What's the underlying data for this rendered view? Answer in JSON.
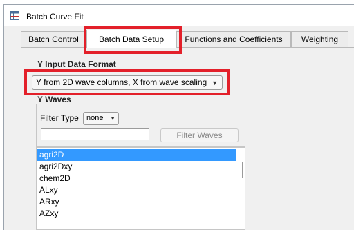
{
  "window": {
    "title": "Batch Curve Fit"
  },
  "tabs": [
    {
      "label": "Batch Control"
    },
    {
      "label": "Batch Data Setup"
    },
    {
      "label": "Functions and Coefficients"
    },
    {
      "label": "Weighting"
    }
  ],
  "y_input": {
    "heading": "Y Input Data Format",
    "selected": "Y from 2D wave columns, X from wave scaling"
  },
  "y_waves": {
    "heading": "Y Waves",
    "filter_type_label": "Filter Type",
    "filter_type_selected": "none",
    "filter_input_value": "",
    "filter_button_label": "Filter Waves",
    "items": [
      "agri2D",
      "agri2Dxy",
      "chem2D",
      "ALxy",
      "ARxy",
      "AZxy"
    ]
  },
  "colors": {
    "highlight": "#e3202a",
    "selection": "#3399ff"
  }
}
